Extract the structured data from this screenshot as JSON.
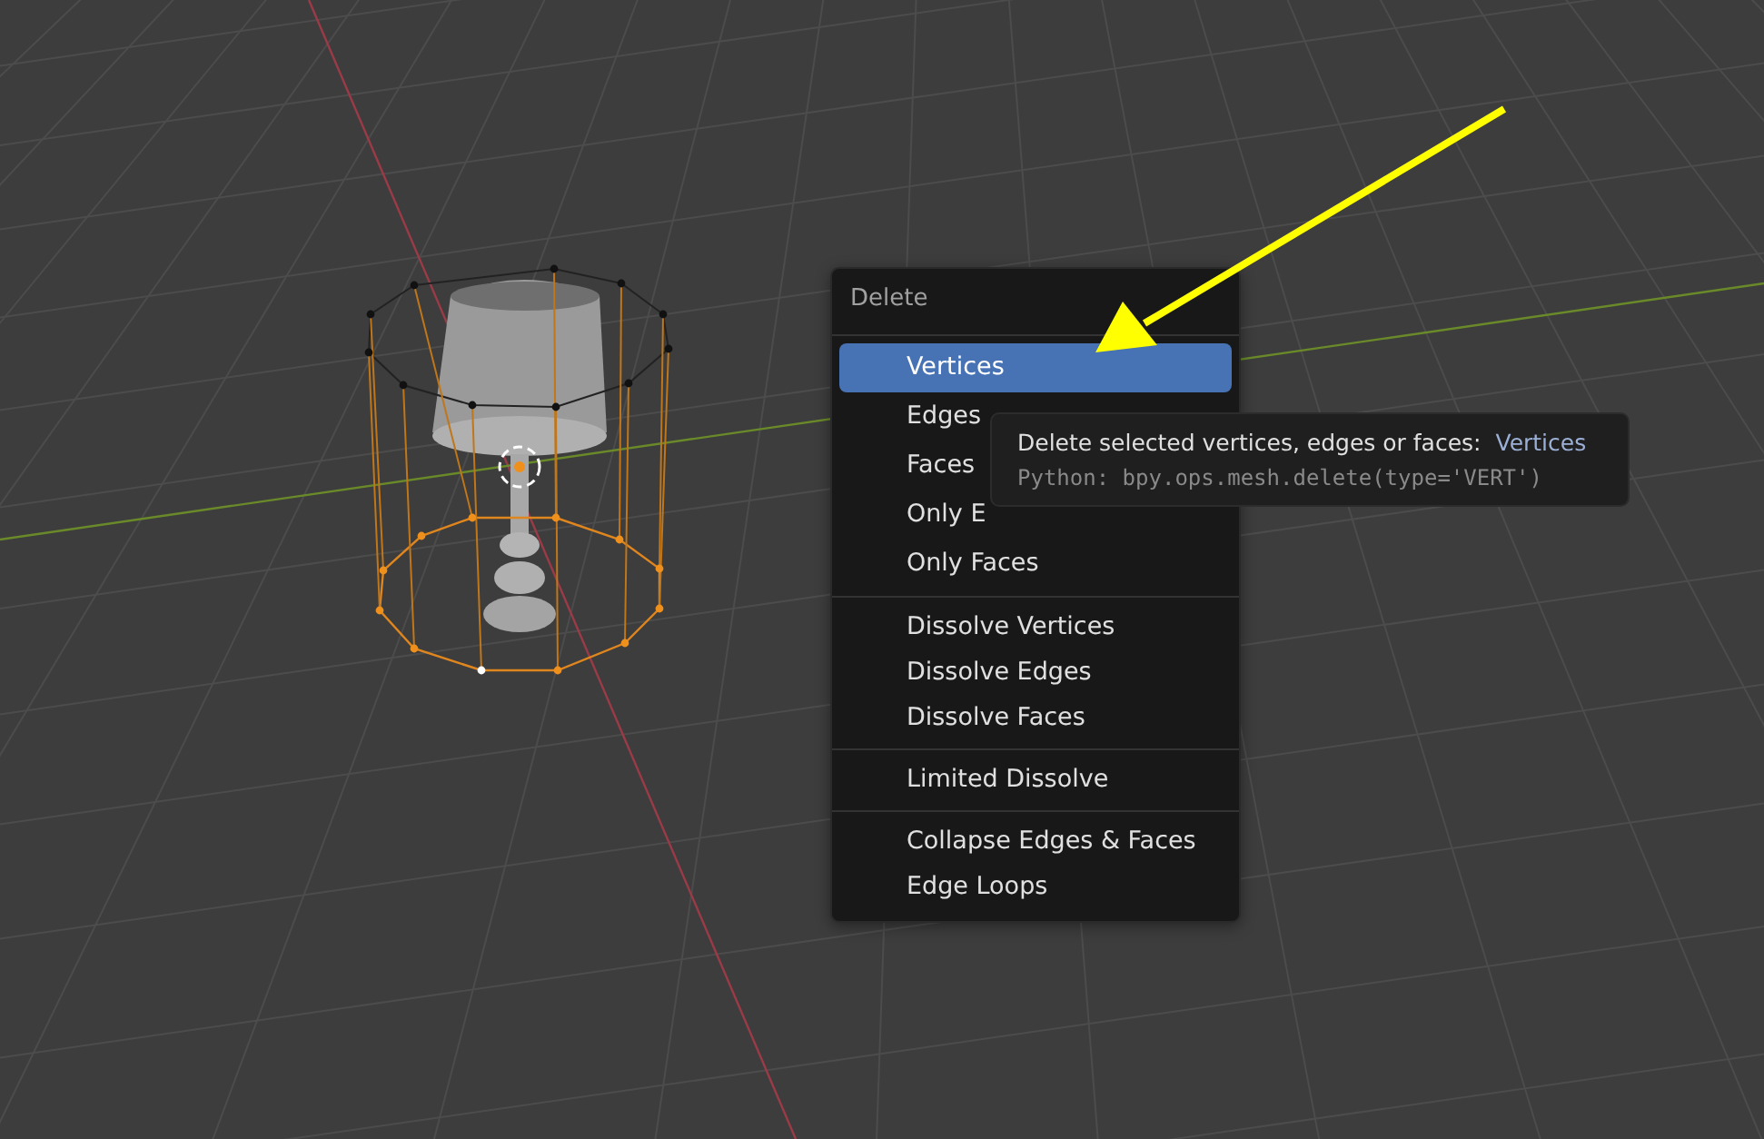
{
  "menu": {
    "title": "Delete",
    "groups": [
      [
        {
          "label": "Vertices",
          "selected": true
        },
        {
          "label": "Edges",
          "selected": false
        },
        {
          "label": "Faces",
          "selected": false
        },
        {
          "label": "Only E",
          "selected": false
        },
        {
          "label": "Only Faces",
          "selected": false
        }
      ],
      [
        {
          "label": "Dissolve Vertices",
          "selected": false
        },
        {
          "label": "Dissolve Edges",
          "selected": false
        },
        {
          "label": "Dissolve Faces",
          "selected": false
        }
      ],
      [
        {
          "label": "Limited Dissolve",
          "selected": false
        }
      ],
      [
        {
          "label": "Collapse Edges & Faces",
          "selected": false
        },
        {
          "label": "Edge Loops",
          "selected": false
        }
      ]
    ]
  },
  "tooltip": {
    "description": "Delete selected vertices, edges or faces:",
    "value": "Vertices",
    "python": "Python: bpy.ops.mesh.delete(type='VERT')"
  }
}
